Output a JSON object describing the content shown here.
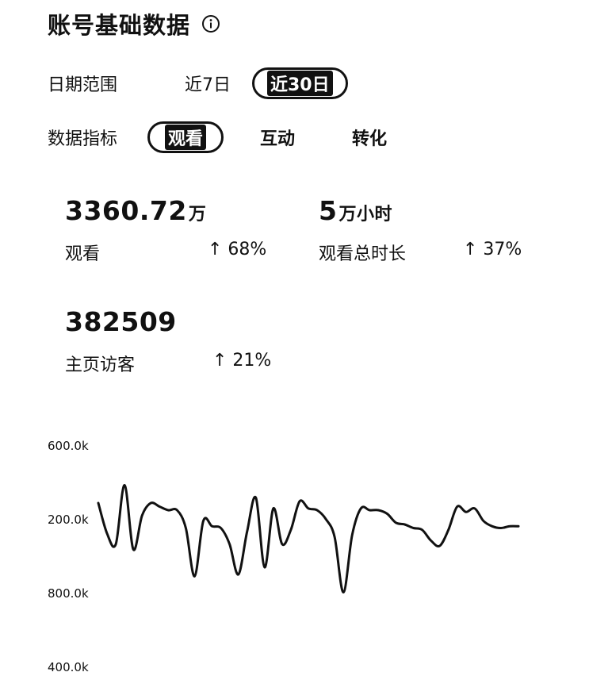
{
  "header": {
    "title": "账号基础数据",
    "info_icon": "info-icon"
  },
  "date_range": {
    "label": "日期范围",
    "options": [
      "近7日",
      "近30日"
    ],
    "selected": "近30日"
  },
  "metric_filter": {
    "label": "数据指标",
    "options": [
      "观看",
      "互动",
      "转化"
    ],
    "selected": "观看"
  },
  "metrics": [
    {
      "value": "3360.72",
      "unit": "万",
      "label": "观看",
      "change": "↑ 68%"
    },
    {
      "value": "5",
      "unit": "万小时",
      "label": "观看总时长",
      "change": "↑ 37%"
    },
    {
      "value": "382509",
      "unit": "",
      "label": "主页访客",
      "change": "↑ 21%"
    }
  ],
  "chart_data": {
    "type": "line",
    "y_tick_labels": [
      "600.0k",
      "200.0k",
      "800.0k",
      "400.0k"
    ],
    "series": [
      {
        "values": [
          1.2,
          0.35,
          0.05,
          1.7,
          -0.1,
          0.85,
          1.2,
          1.1,
          1.0,
          1.0,
          0.5,
          -0.85,
          0.7,
          0.55,
          0.5,
          0.05,
          -0.8,
          0.4,
          1.35,
          -0.6,
          1.05,
          0.05,
          0.45,
          1.25,
          1.05,
          1.0,
          0.75,
          0.25,
          -1.3,
          0.3,
          1.05,
          1.0,
          1.0,
          0.9,
          0.65,
          0.6,
          0.5,
          0.45,
          0.15,
          0.0,
          0.45,
          1.1,
          0.95,
          1.05,
          0.7,
          0.55,
          0.5,
          0.55,
          0.55
        ]
      }
    ],
    "line_color": "#111111"
  }
}
